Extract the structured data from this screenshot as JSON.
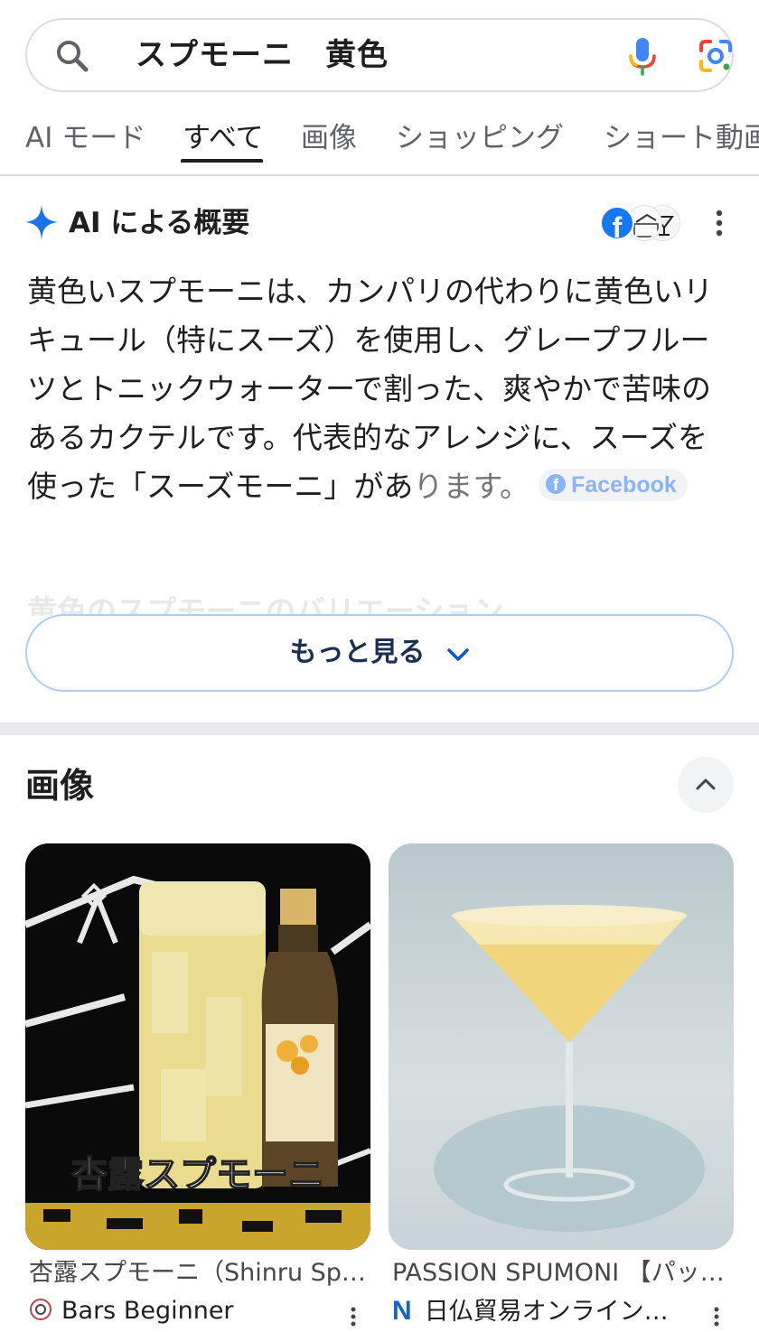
{
  "search": {
    "query": "スプモーニ　黄色"
  },
  "tabs": [
    {
      "label": "AI モード"
    },
    {
      "label": "すべて",
      "active": true
    },
    {
      "label": "画像"
    },
    {
      "label": "ショッピング"
    },
    {
      "label": "ショート動画"
    }
  ],
  "ai_overview": {
    "title": "AI による概要",
    "body": "黄色いスプモーニは、カンパリの代わりに黄色いリキュール（特にスーズ）を使用し、グレープフルーツとトニックウォーターで割った、爽やかで苦味のあるカクテルです。代表的なアレンジに、スーズを使った「スーズモーニ」があ",
    "body_last": "ります。",
    "source_chip": "Facebook",
    "fb_letter": "f",
    "faded_heading": "黄色のスプモーニのバリエーション",
    "more_button": "もっと見る"
  },
  "images": {
    "title": "画像",
    "cards": [
      {
        "caption": "杏露スプモーニ（Shinru Sp…",
        "source": "Bars Beginner",
        "overlay_text": "杏露スプモーニ"
      },
      {
        "caption": "PASSION SPUMONI 【パッ…",
        "source": "日仏貿易オンライン…",
        "source_logo": "N"
      }
    ]
  },
  "colors": {
    "accent_blue": "#0b57d0",
    "chip_blue": "#8ab4f8",
    "facebook": "#1877f2",
    "divider": "#dadce0"
  }
}
